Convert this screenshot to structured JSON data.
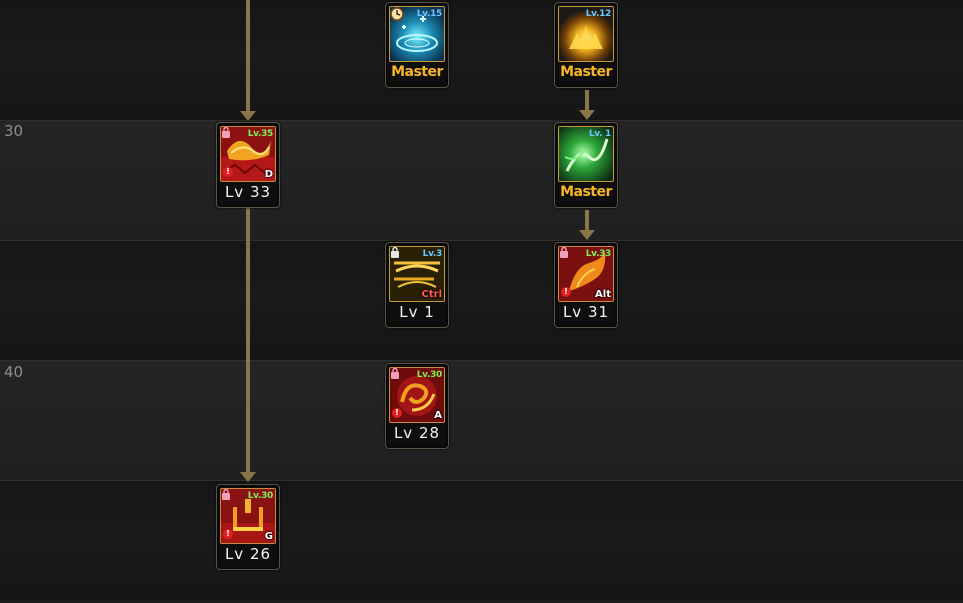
{
  "rows": [
    {
      "label": ""
    },
    {
      "label": "30"
    },
    {
      "label": ""
    },
    {
      "label": "40"
    },
    {
      "label": ""
    }
  ],
  "skills": {
    "frost_circle": {
      "level_tag": "Lv.15",
      "caption": "Master",
      "icon": "frost-magic-circle-icon"
    },
    "flame_burst": {
      "level_tag": "Lv.12",
      "caption": "Master",
      "icon": "flame-burst-icon"
    },
    "green_aura": {
      "level_tag": "Lv. 1",
      "caption": "Master",
      "icon": "green-aura-icon"
    },
    "fire_strike": {
      "level_tag": "Lv.35",
      "caption": "Lv 33",
      "hotkey": "D",
      "icon": "fire-strike-icon"
    },
    "flame_dash": {
      "level_tag": "Lv.33",
      "caption": "Lv 31",
      "hotkey": "Alt",
      "icon": "flame-dash-icon"
    },
    "golden_wave": {
      "level_tag": "Lv.3",
      "caption": "Lv 1",
      "hotkey": "Ctrl",
      "icon": "golden-wave-icon"
    },
    "fire_swirl": {
      "level_tag": "Lv.30",
      "caption": "Lv 28",
      "hotkey": "A",
      "icon": "fire-swirl-icon"
    },
    "blade_pillar": {
      "level_tag": "Lv.30",
      "caption": "Lv 26",
      "hotkey": "G",
      "icon": "blade-pillar-icon"
    }
  },
  "colors": {
    "master_text": "#f7b52a",
    "connector": "#8a7448",
    "level_tag_blue": "#6cc6ff",
    "level_tag_green": "#7cf05a"
  }
}
